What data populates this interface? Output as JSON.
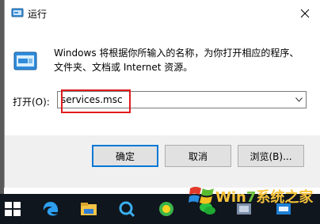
{
  "dialog": {
    "title": "运行",
    "description": "Windows 将根据你所输入的名称，为你打开相应的程序、文件夹、文档或 Internet 资源。",
    "open_label": "打开(O):",
    "open_value": "services.msc",
    "buttons": {
      "ok": "确定",
      "cancel": "取消",
      "browse": "浏览(B)..."
    }
  },
  "taskbar": {
    "icons": [
      "windows-start-icon",
      "edge-icon",
      "file-explorer-icon",
      "search-icon",
      "360-browser-icon",
      "wechat-icon",
      "app-icon",
      "app-icon"
    ]
  },
  "watermark": {
    "text_prefix": "Wi",
    "text_n": "n",
    "text_7": "7",
    "text_suffix": "系统之家"
  },
  "colors": {
    "highlight": "#e21b1b",
    "accent": "#0078d7",
    "taskbar": "#10161e"
  }
}
